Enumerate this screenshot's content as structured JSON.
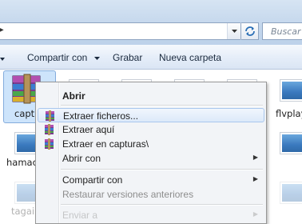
{
  "header": {
    "search_placeholder": "Buscar S",
    "addr_icon": "back-arrow-icon",
    "dropdown_icon": "chevron-down-icon",
    "refresh_icon": "refresh-icon"
  },
  "toolbar": {
    "share_label": "Compartir con",
    "record_label": "Grabar",
    "new_folder_label": "Nueva carpeta"
  },
  "files": {
    "items": [
      {
        "label": "captur"
      },
      {
        "label": "flvplay"
      },
      {
        "label": "hamach"
      },
      {
        "label": "tagain"
      }
    ]
  },
  "context_menu": {
    "items": [
      {
        "label": "Abrir",
        "bold": true,
        "icon": ""
      },
      {
        "label": "Extraer ficheros...",
        "icon": "winrar-icon",
        "highlighted": true
      },
      {
        "label": "Extraer aquí",
        "icon": "winrar-icon"
      },
      {
        "label": "Extraer en capturas\\",
        "icon": "winrar-icon"
      },
      {
        "label": "Abrir con",
        "submenu": true
      },
      {
        "label": "Compartir con",
        "submenu": true
      },
      {
        "label": "Restaurar versiones anteriores",
        "disabled": true
      },
      {
        "label": "Enviar a",
        "submenu": true,
        "disabled": true
      }
    ]
  },
  "colors": {
    "chrome": "#c3d6ec",
    "selection": "#cde4fb",
    "menu_bg": "#f2f4f7",
    "menu_highlight": "#dce9f9"
  }
}
